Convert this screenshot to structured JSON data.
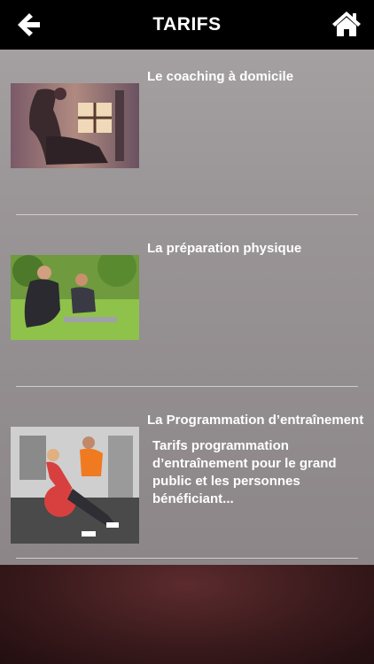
{
  "header": {
    "title": "TARIFS",
    "back_icon": "arrow-left-icon",
    "home_icon": "home-icon"
  },
  "items": [
    {
      "title": "Le coaching à domicile",
      "image": "home-coaching-photo"
    },
    {
      "title": "La préparation physique",
      "image": "physical-preparation-photo"
    },
    {
      "title": "La Programmation d’entraînement",
      "description": "Tarifs programmation d’entraînement pour le grand public et les personnes bénéficiant...",
      "image": "training-program-photo"
    }
  ],
  "colors": {
    "topbar": "#000000",
    "text": "#ffffff"
  }
}
